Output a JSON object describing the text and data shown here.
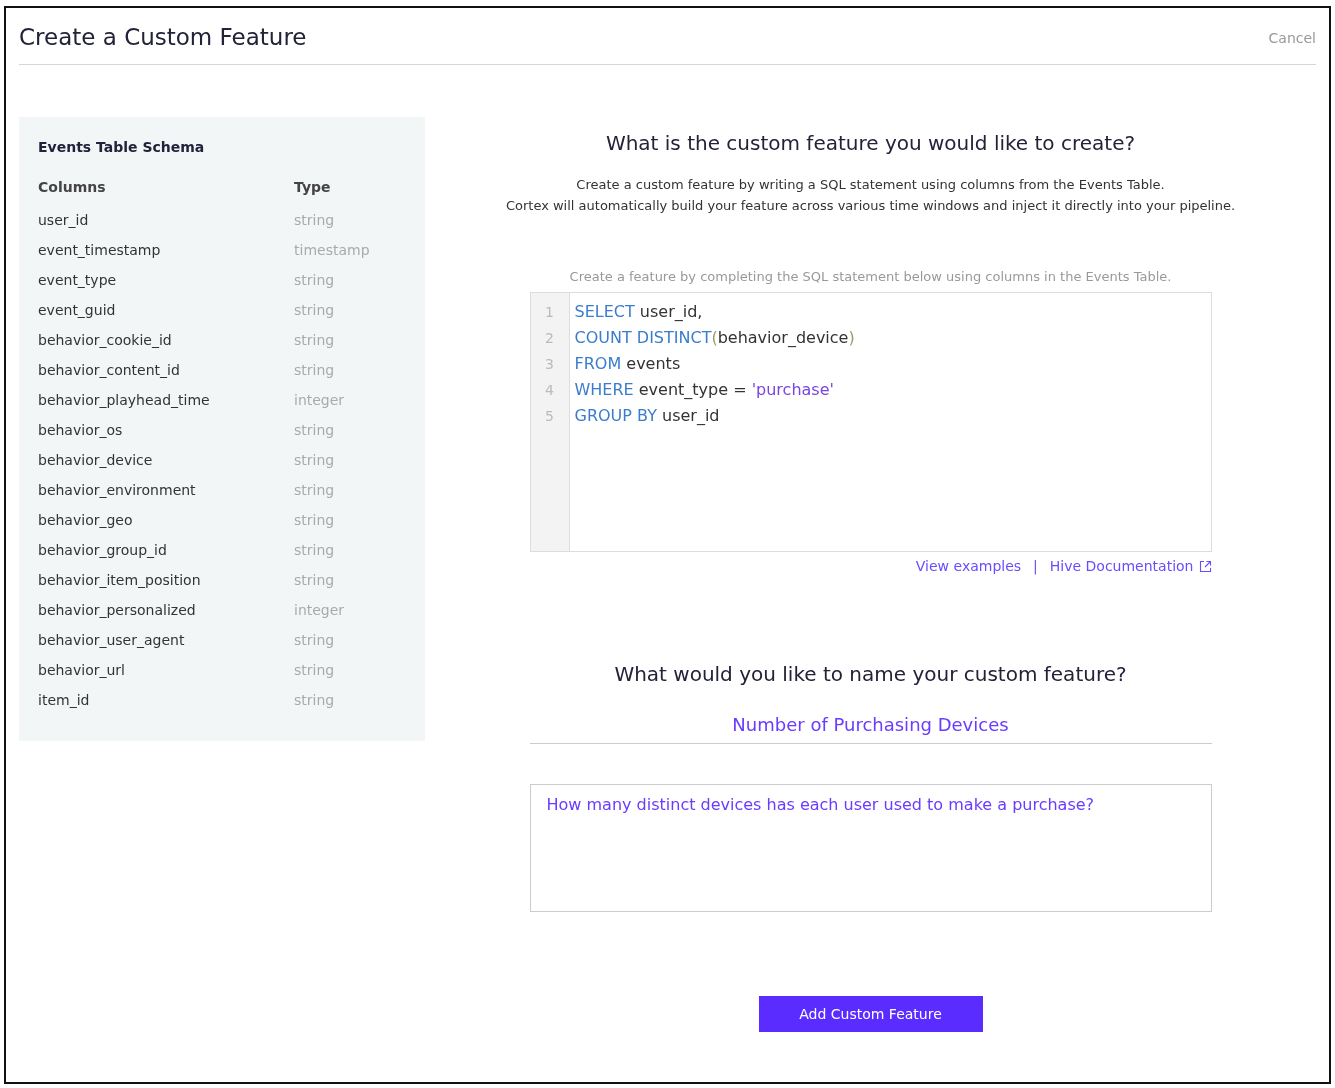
{
  "header": {
    "title": "Create a Custom Feature",
    "cancel": "Cancel"
  },
  "schema": {
    "title": "Events Table Schema",
    "columns_heading": "Columns",
    "type_heading": "Type",
    "rows": [
      {
        "column": "user_id",
        "type": "string"
      },
      {
        "column": "event_timestamp",
        "type": "timestamp"
      },
      {
        "column": "event_type",
        "type": "string"
      },
      {
        "column": "event_guid",
        "type": "string"
      },
      {
        "column": "behavior_cookie_id",
        "type": "string"
      },
      {
        "column": "behavior_content_id",
        "type": "string"
      },
      {
        "column": "behavior_playhead_time",
        "type": "integer"
      },
      {
        "column": "behavior_os",
        "type": "string"
      },
      {
        "column": "behavior_device",
        "type": "string"
      },
      {
        "column": "behavior_environment",
        "type": "string"
      },
      {
        "column": "behavior_geo",
        "type": "string"
      },
      {
        "column": "behavior_group_id",
        "type": "string"
      },
      {
        "column": "behavior_item_position",
        "type": "string"
      },
      {
        "column": "behavior_personalized",
        "type": "integer"
      },
      {
        "column": "behavior_user_agent",
        "type": "string"
      },
      {
        "column": "behavior_url",
        "type": "string"
      },
      {
        "column": "item_id",
        "type": "string"
      }
    ]
  },
  "query_section": {
    "heading": "What is the custom feature you would like to create?",
    "description": [
      "Create a custom feature by writing a SQL statement using columns from the Events Table.",
      "Cortex will automatically build your feature across various time windows and inject it directly into your pipeline."
    ],
    "editor_hint": "Create a feature by completing the SQL statement below using columns in the Events Table.",
    "code_lines": [
      {
        "number": "1",
        "tokens": [
          {
            "kind": "keyword",
            "text": "SELECT"
          },
          {
            "kind": "plain",
            "text": " user_id,"
          }
        ]
      },
      {
        "number": "2",
        "tokens": [
          {
            "kind": "keyword",
            "text": "COUNT DISTINCT"
          },
          {
            "kind": "paren",
            "text": "("
          },
          {
            "kind": "plain",
            "text": "behavior_device"
          },
          {
            "kind": "paren",
            "text": ")"
          }
        ]
      },
      {
        "number": "3",
        "tokens": [
          {
            "kind": "keyword",
            "text": "FROM"
          },
          {
            "kind": "plain",
            "text": " events"
          }
        ]
      },
      {
        "number": "4",
        "tokens": [
          {
            "kind": "keyword",
            "text": "WHERE"
          },
          {
            "kind": "plain",
            "text": " event_type = "
          },
          {
            "kind": "string",
            "text": "'purchase'"
          }
        ]
      },
      {
        "number": "5",
        "tokens": [
          {
            "kind": "keyword",
            "text": "GROUP BY"
          },
          {
            "kind": "plain",
            "text": " user_id"
          }
        ]
      }
    ],
    "links": [
      {
        "label": "View examples",
        "external": false
      },
      {
        "label": "Hive Documentation",
        "external": true
      }
    ],
    "link_separator": "|"
  },
  "name_section": {
    "heading": "What would you like to name your custom feature?",
    "name_value": "Number of Purchasing Devices",
    "description_value": "How many distinct devices has each user used to make a purchase?"
  },
  "submit_button": "Add Custom Feature"
}
